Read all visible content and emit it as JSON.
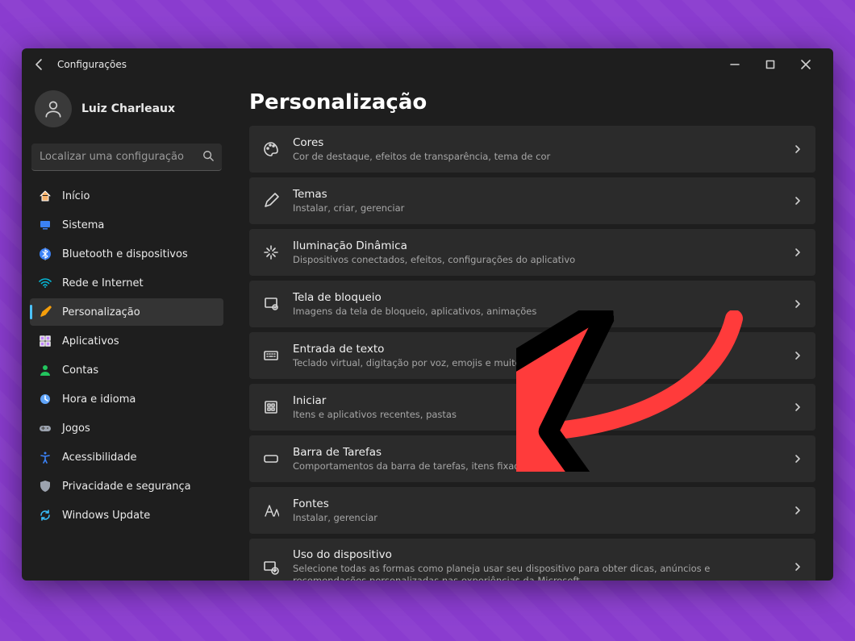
{
  "window": {
    "title": "Configurações"
  },
  "profile": {
    "name": "Luiz Charleaux"
  },
  "search": {
    "placeholder": "Localizar uma configuração"
  },
  "sidebar": {
    "items": [
      {
        "label": "Início",
        "icon": "home-icon",
        "color": "#f6b26b"
      },
      {
        "label": "Sistema",
        "icon": "system-icon",
        "color": "#3b82f6"
      },
      {
        "label": "Bluetooth e dispositivos",
        "icon": "bluetooth-icon",
        "color": "#3b82f6"
      },
      {
        "label": "Rede e Internet",
        "icon": "wifi-icon",
        "color": "#06b6d4"
      },
      {
        "label": "Personalização",
        "icon": "brush-icon",
        "color": "#f59e0b",
        "active": true
      },
      {
        "label": "Aplicativos",
        "icon": "apps-icon",
        "color": "#c084fc"
      },
      {
        "label": "Contas",
        "icon": "account-icon",
        "color": "#22c55e"
      },
      {
        "label": "Hora e idioma",
        "icon": "time-icon",
        "color": "#60a5fa"
      },
      {
        "label": "Jogos",
        "icon": "gaming-icon",
        "color": "#9ca3af"
      },
      {
        "label": "Acessibilidade",
        "icon": "accessibility-icon",
        "color": "#3b82f6"
      },
      {
        "label": "Privacidade e segurança",
        "icon": "shield-icon",
        "color": "#9ca3af"
      },
      {
        "label": "Windows Update",
        "icon": "update-icon",
        "color": "#38bdf8"
      }
    ]
  },
  "page": {
    "heading": "Personalização"
  },
  "cards": [
    {
      "icon": "palette-icon",
      "title": "Cores",
      "desc": "Cor de destaque, efeitos de transparência, tema de cor"
    },
    {
      "icon": "pen-icon",
      "title": "Temas",
      "desc": "Instalar, criar, gerenciar"
    },
    {
      "icon": "sparkle-icon",
      "title": "Iluminação Dinâmica",
      "desc": "Dispositivos conectados, efeitos, configurações do aplicativo"
    },
    {
      "icon": "lock-image-icon",
      "title": "Tela de bloqueio",
      "desc": "Imagens da tela de bloqueio, aplicativos, animações"
    },
    {
      "icon": "keyboard-icon",
      "title": "Entrada de texto",
      "desc": "Teclado virtual, digitação por voz, emojis e muito mais, IME"
    },
    {
      "icon": "start-icon",
      "title": "Iniciar",
      "desc": "Itens e aplicativos recentes, pastas"
    },
    {
      "icon": "taskbar-icon",
      "title": "Barra de Tarefas",
      "desc": "Comportamentos da barra de tarefas, itens fixados do sistema"
    },
    {
      "icon": "font-icon",
      "title": "Fontes",
      "desc": "Instalar, gerenciar"
    },
    {
      "icon": "device-use-icon",
      "title": "Uso do dispositivo",
      "desc": "Selecione todas as formas como planeja usar seu dispositivo para obter dicas, anúncios e recomendações personalizadas nas experiências da Microsoft."
    }
  ],
  "annotation": {
    "arrow_color": "#ff3b3b",
    "target_card_index": 6
  }
}
